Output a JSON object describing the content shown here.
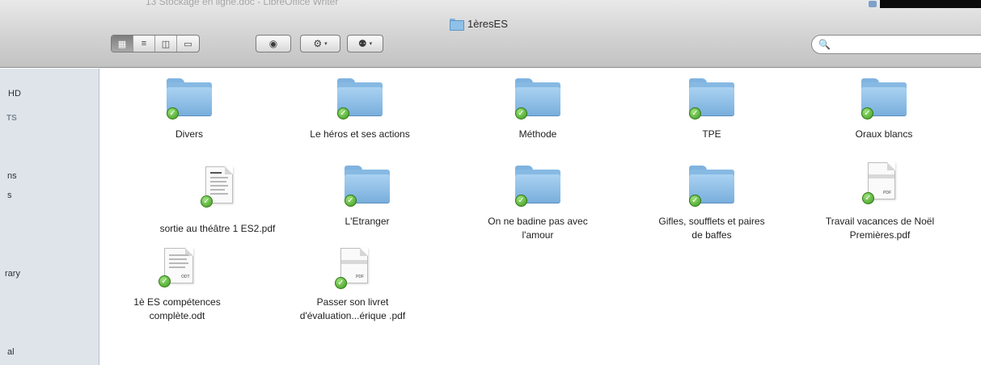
{
  "window": {
    "title": "1èresES",
    "behind_title": "13   Stockage en ligne.doc - LibreOffice Writer"
  },
  "toolbar": {
    "view_modes": [
      {
        "name": "icon-view",
        "glyph": "▦",
        "active": true
      },
      {
        "name": "list-view",
        "glyph": "≡",
        "active": false
      },
      {
        "name": "column-view",
        "glyph": "◫",
        "active": false
      },
      {
        "name": "coverflow-view",
        "glyph": "▭",
        "active": false
      }
    ],
    "quicklook_glyph": "◉",
    "action_glyph": "⚙",
    "share_glyph": "⚉",
    "dropdown_glyph": "▾",
    "search": {
      "glyph": "🔍",
      "placeholder": ""
    }
  },
  "sidebar": {
    "items": [
      {
        "label": "HD",
        "style": "normal"
      },
      {
        "label": "TS",
        "style": "head"
      },
      {
        "label": "ns",
        "style": "normal"
      },
      {
        "label": "s",
        "style": "normal"
      },
      {
        "label": "rary",
        "style": "normal"
      },
      {
        "label": "al",
        "style": "normal"
      }
    ]
  },
  "files": {
    "row1": [
      {
        "name": "Divers",
        "kind": "folder"
      },
      {
        "name": "Le héros et ses actions",
        "kind": "folder"
      },
      {
        "name": "Méthode",
        "kind": "folder"
      },
      {
        "name": "TPE",
        "kind": "folder"
      },
      {
        "name": "Oraux blancs",
        "kind": "folder"
      }
    ],
    "row2": [
      {
        "name": "sortie au théâtre 1 ES2.pdf",
        "kind": "scan"
      },
      {
        "name": "L'Etranger",
        "kind": "folder"
      },
      {
        "name_line1": "On ne badine pas avec",
        "name_line2": "l'amour",
        "kind": "folder"
      },
      {
        "name_line1": "Gifles, soufflets et paires",
        "name_line2": "de baffes",
        "kind": "folder"
      },
      {
        "name_line1": "Travail vacances de Noël",
        "name_line2": "Premières.pdf",
        "kind": "pdf",
        "tag": "PDF"
      }
    ],
    "row3": [
      {
        "name_line1": "1è ES compétences",
        "name_line2": "complète.odt",
        "kind": "odt",
        "tag": "ODT"
      },
      {
        "name_line1": "Passer son livret",
        "name_line2": "d'évaluation...érique .pdf",
        "kind": "pdf",
        "tag": "PDF"
      }
    ]
  },
  "colors": {
    "folder_blue": "#8fc0e8",
    "sync_check_green": "#3f9a1f",
    "sidebar_bg": "#dfe4eb"
  }
}
